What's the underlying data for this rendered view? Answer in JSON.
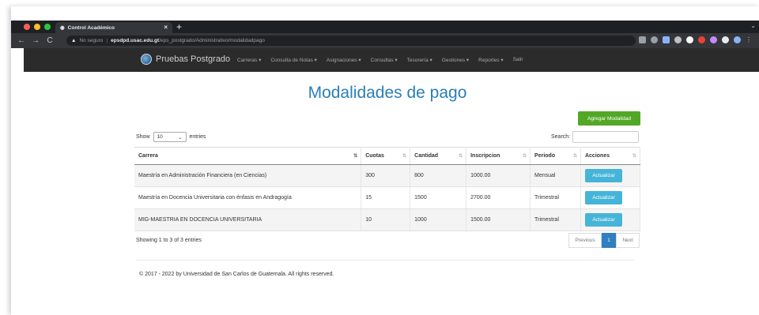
{
  "browser": {
    "tab_title": "Control Académico",
    "tab_close": "×",
    "new_tab": "+",
    "security_label": "No seguro",
    "url_host": "epsdpd.usac.edu.gt",
    "url_path": "/eps_postgrado/Administrativo/modalidadpago"
  },
  "app": {
    "brand": "Pruebas Postgrado",
    "menu": [
      "Carreras ▾",
      "Consulta de Notas ▾",
      "Asignaciones ▾",
      "Consultas ▾",
      "Tesorería ▾",
      "Gestiones ▾",
      "Reportes ▾",
      "Salir"
    ]
  },
  "page": {
    "title": "Modalidades de pago",
    "add_button": "Agregar Modalidad",
    "show_label": "Show",
    "entries_value": "10",
    "entries_label": "entries",
    "search_label": "Search:",
    "info": "Showing 1 to 3 of 3 entries",
    "pager": {
      "previous": "Previous",
      "current": "1",
      "next": "Next"
    },
    "footer": "© 2017 - 2022 by Universidad de San Carlos de Guatemala. All rights reserved."
  },
  "table": {
    "headers": [
      "Carrera",
      "Cuotas",
      "Cantidad",
      "Inscripcion",
      "Periodo",
      "Acciones"
    ],
    "rows": [
      [
        "Maestría en Administración Financiera (en Ciencias)",
        "300",
        "800",
        "1000.00",
        "Mensual",
        "Actualizar"
      ],
      [
        "Maestría en Docencia Universitaria con énfasis en Andragogía",
        "15",
        "1500",
        "2700.00",
        "Trimestral",
        "Actualizar"
      ],
      [
        "MIG-MAESTRIA EN DOCENCIA UNIVERSITARIA",
        "10",
        "1000",
        "1500.00",
        "Trimestral",
        "Actualizar"
      ]
    ]
  },
  "colors": {
    "title": "#2a7fb5",
    "add_button": "#52a826",
    "update_button": "#46b4d8",
    "pager_active": "#2f7fc1"
  }
}
